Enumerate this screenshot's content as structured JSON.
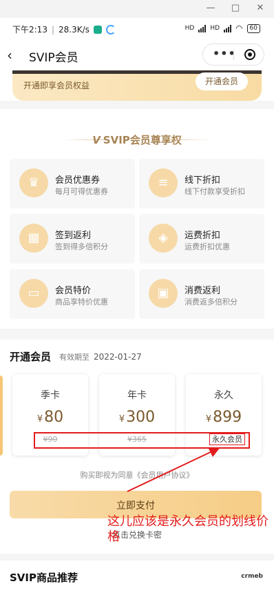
{
  "window": {
    "min": "—",
    "max": "□",
    "close": "✕"
  },
  "status_bar": {
    "time": "下午2:13",
    "speed": "28.3K/s",
    "battery": "60",
    "hd1": "HD",
    "hd2": "HD"
  },
  "nav": {
    "back": "‹",
    "title": "SVIP会员",
    "more": "•••"
  },
  "banner": {
    "text": "开通即享会员权益",
    "button": "开通会员"
  },
  "privileges": {
    "badge": "V",
    "title": "SVIP会员尊享权",
    "items": [
      {
        "title": "会员优惠券",
        "desc": "每月可得优惠券",
        "icon": "crown-icon",
        "glyph": "♛"
      },
      {
        "title": "线下折扣",
        "desc": "线下付款享受折扣",
        "icon": "coins-icon",
        "glyph": "≡"
      },
      {
        "title": "签到返利",
        "desc": "签到得多倍积分",
        "icon": "calendar-icon",
        "glyph": "▦"
      },
      {
        "title": "运费折扣",
        "desc": "运费折扣优惠",
        "icon": "tag-icon",
        "glyph": "◈"
      },
      {
        "title": "会员特价",
        "desc": "商品享特价优惠",
        "icon": "ticket-icon",
        "glyph": "▭"
      },
      {
        "title": "消费返利",
        "desc": "消费返多倍积分",
        "icon": "wallet-icon",
        "glyph": "▣"
      }
    ]
  },
  "membership": {
    "heading": "开通会员",
    "expiry_label": "有效期至",
    "expiry_date": "2022-01-27",
    "plans": [
      {
        "name": "季卡",
        "currency": "¥",
        "price": "80",
        "original": "¥90"
      },
      {
        "name": "年卡",
        "currency": "¥",
        "price": "300",
        "original": "¥365"
      },
      {
        "name": "永久",
        "currency": "¥",
        "price": "899",
        "tag": "永久会员"
      }
    ],
    "agreement": "购买即视为同意《会员用户协议》",
    "pay_button": "立即支付",
    "redeem": "点击兑换卡密",
    "annotation": "这儿应该是永久会员的划线价格"
  },
  "recommend": {
    "title": "SVIP商品推荐",
    "logo": "crmeb"
  },
  "colors": {
    "gold": "#a88455",
    "annotation_red": "#e31b1b",
    "pay_start": "#f8dba8",
    "pay_end": "#f6cd86"
  }
}
